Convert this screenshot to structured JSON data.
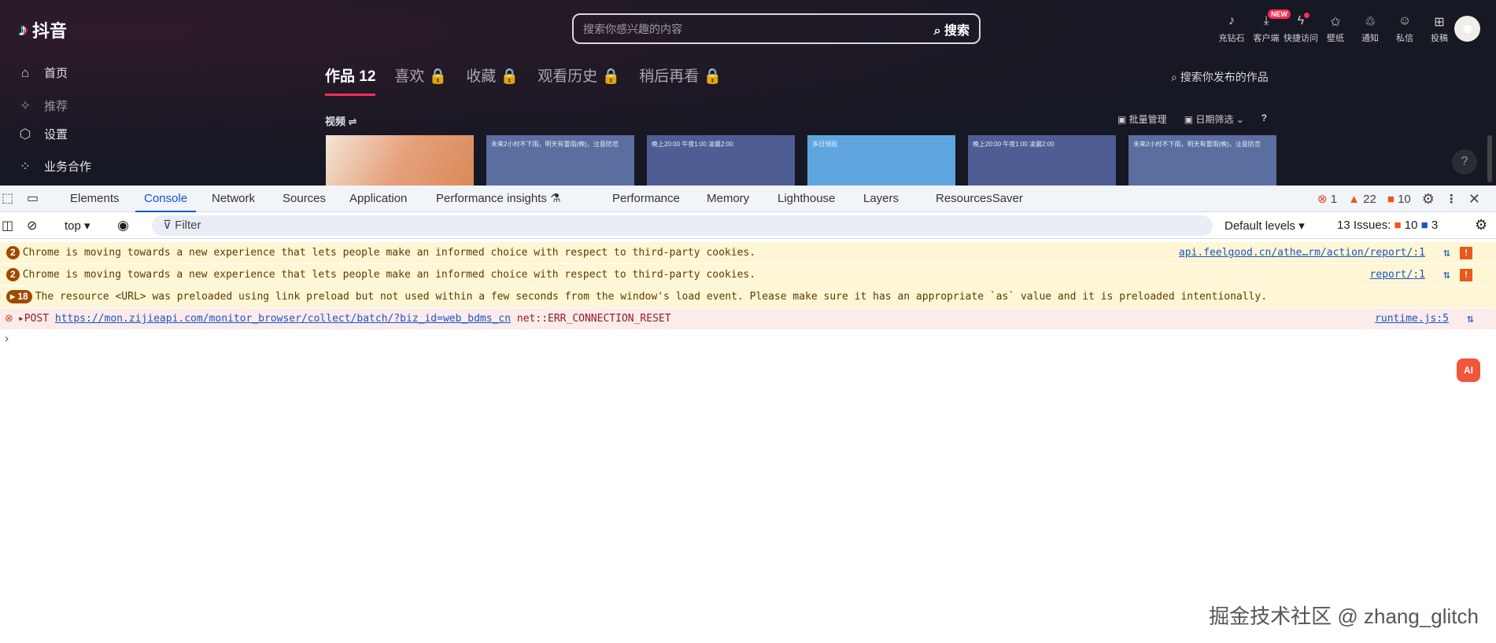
{
  "app": {
    "logo": "抖音",
    "sidebar": [
      {
        "icon": "home-icon",
        "label": "首页"
      },
      {
        "icon": "sparkle-icon",
        "label": "推荐"
      },
      {
        "icon": "settings-icon",
        "label": "设置"
      },
      {
        "icon": "grid-icon",
        "label": "业务合作"
      }
    ],
    "search": {
      "placeholder": "搜索你感兴趣的内容",
      "button": "搜索"
    },
    "top_icons": [
      {
        "icon": "tiktok-icon",
        "label": "充钻石"
      },
      {
        "icon": "download-icon",
        "label": "客户端",
        "badge": "NEW"
      },
      {
        "icon": "lightning-icon",
        "label": "快捷访问"
      },
      {
        "icon": "wallpaper-icon",
        "label": "壁纸"
      },
      {
        "icon": "bell-icon",
        "label": "通知"
      },
      {
        "icon": "chat-icon",
        "label": "私信"
      },
      {
        "icon": "plus-icon",
        "label": "投稿"
      }
    ],
    "tabs": [
      "作品 12",
      "喜欢 🔒",
      "收藏 🔒",
      "观看历史 🔒",
      "稍后再看 🔒"
    ],
    "search_works": "搜索你发布的作品",
    "section": "视频",
    "tools": [
      "批量管理",
      "日期筛选",
      "?"
    ],
    "thumb_texts": [
      "",
      "未来2小时不下雨，明天有雷雨(晚)，注意防范",
      "晚上20:00  午夜1:00  凌晨2:00",
      "多日预报",
      "晚上20:00  午夜1:00  凌晨2:00",
      "未来2小时不下雨，明天有雷雨(晚)，注意防范"
    ]
  },
  "devtools": {
    "tabs": [
      "Elements",
      "Console",
      "Network",
      "Sources",
      "Application",
      "Performance insights",
      "Performance",
      "Memory",
      "Lighthouse",
      "Layers",
      "ResourcesSaver"
    ],
    "active_tab": "Console",
    "counts": {
      "errors": "1",
      "warnings": "22",
      "issues": "10"
    },
    "toolbar": {
      "context": "top",
      "filter": "Filter",
      "levels": "Default levels",
      "issues_label": "13 Issues:",
      "issues_warn": "10",
      "issues_info": "3"
    },
    "messages": [
      {
        "type": "warning",
        "count": "2",
        "text": "Chrome is moving towards a new experience that lets people make an informed choice with respect to third-party cookies.",
        "source": "api.feelgood.cn/athe…rm/action/report/:1"
      },
      {
        "type": "warning",
        "count": "2",
        "text": "Chrome is moving towards a new experience that lets people make an informed choice with respect to third-party cookies.",
        "source": "report/:1"
      },
      {
        "type": "warning",
        "count": "18",
        "text": "The resource <URL> was preloaded using link preload but not used within a few seconds from the window's load event. Please make sure it has an appropriate `as` value and it is preloaded intentionally."
      },
      {
        "type": "error",
        "method": "POST",
        "url": "https://mon.zijieapi.com/monitor_browser/collect/batch/?biz_id=web_bdms_cn",
        "text": "net::ERR_CONNECTION_RESET",
        "source": "runtime.js:5"
      }
    ],
    "prompt": "›"
  },
  "ai_button": "AI",
  "watermark": "掘金技术社区 @ zhang_glitch",
  "colors": {
    "brand": "#fe2c55",
    "devtools_accent": "#0b57d0"
  }
}
